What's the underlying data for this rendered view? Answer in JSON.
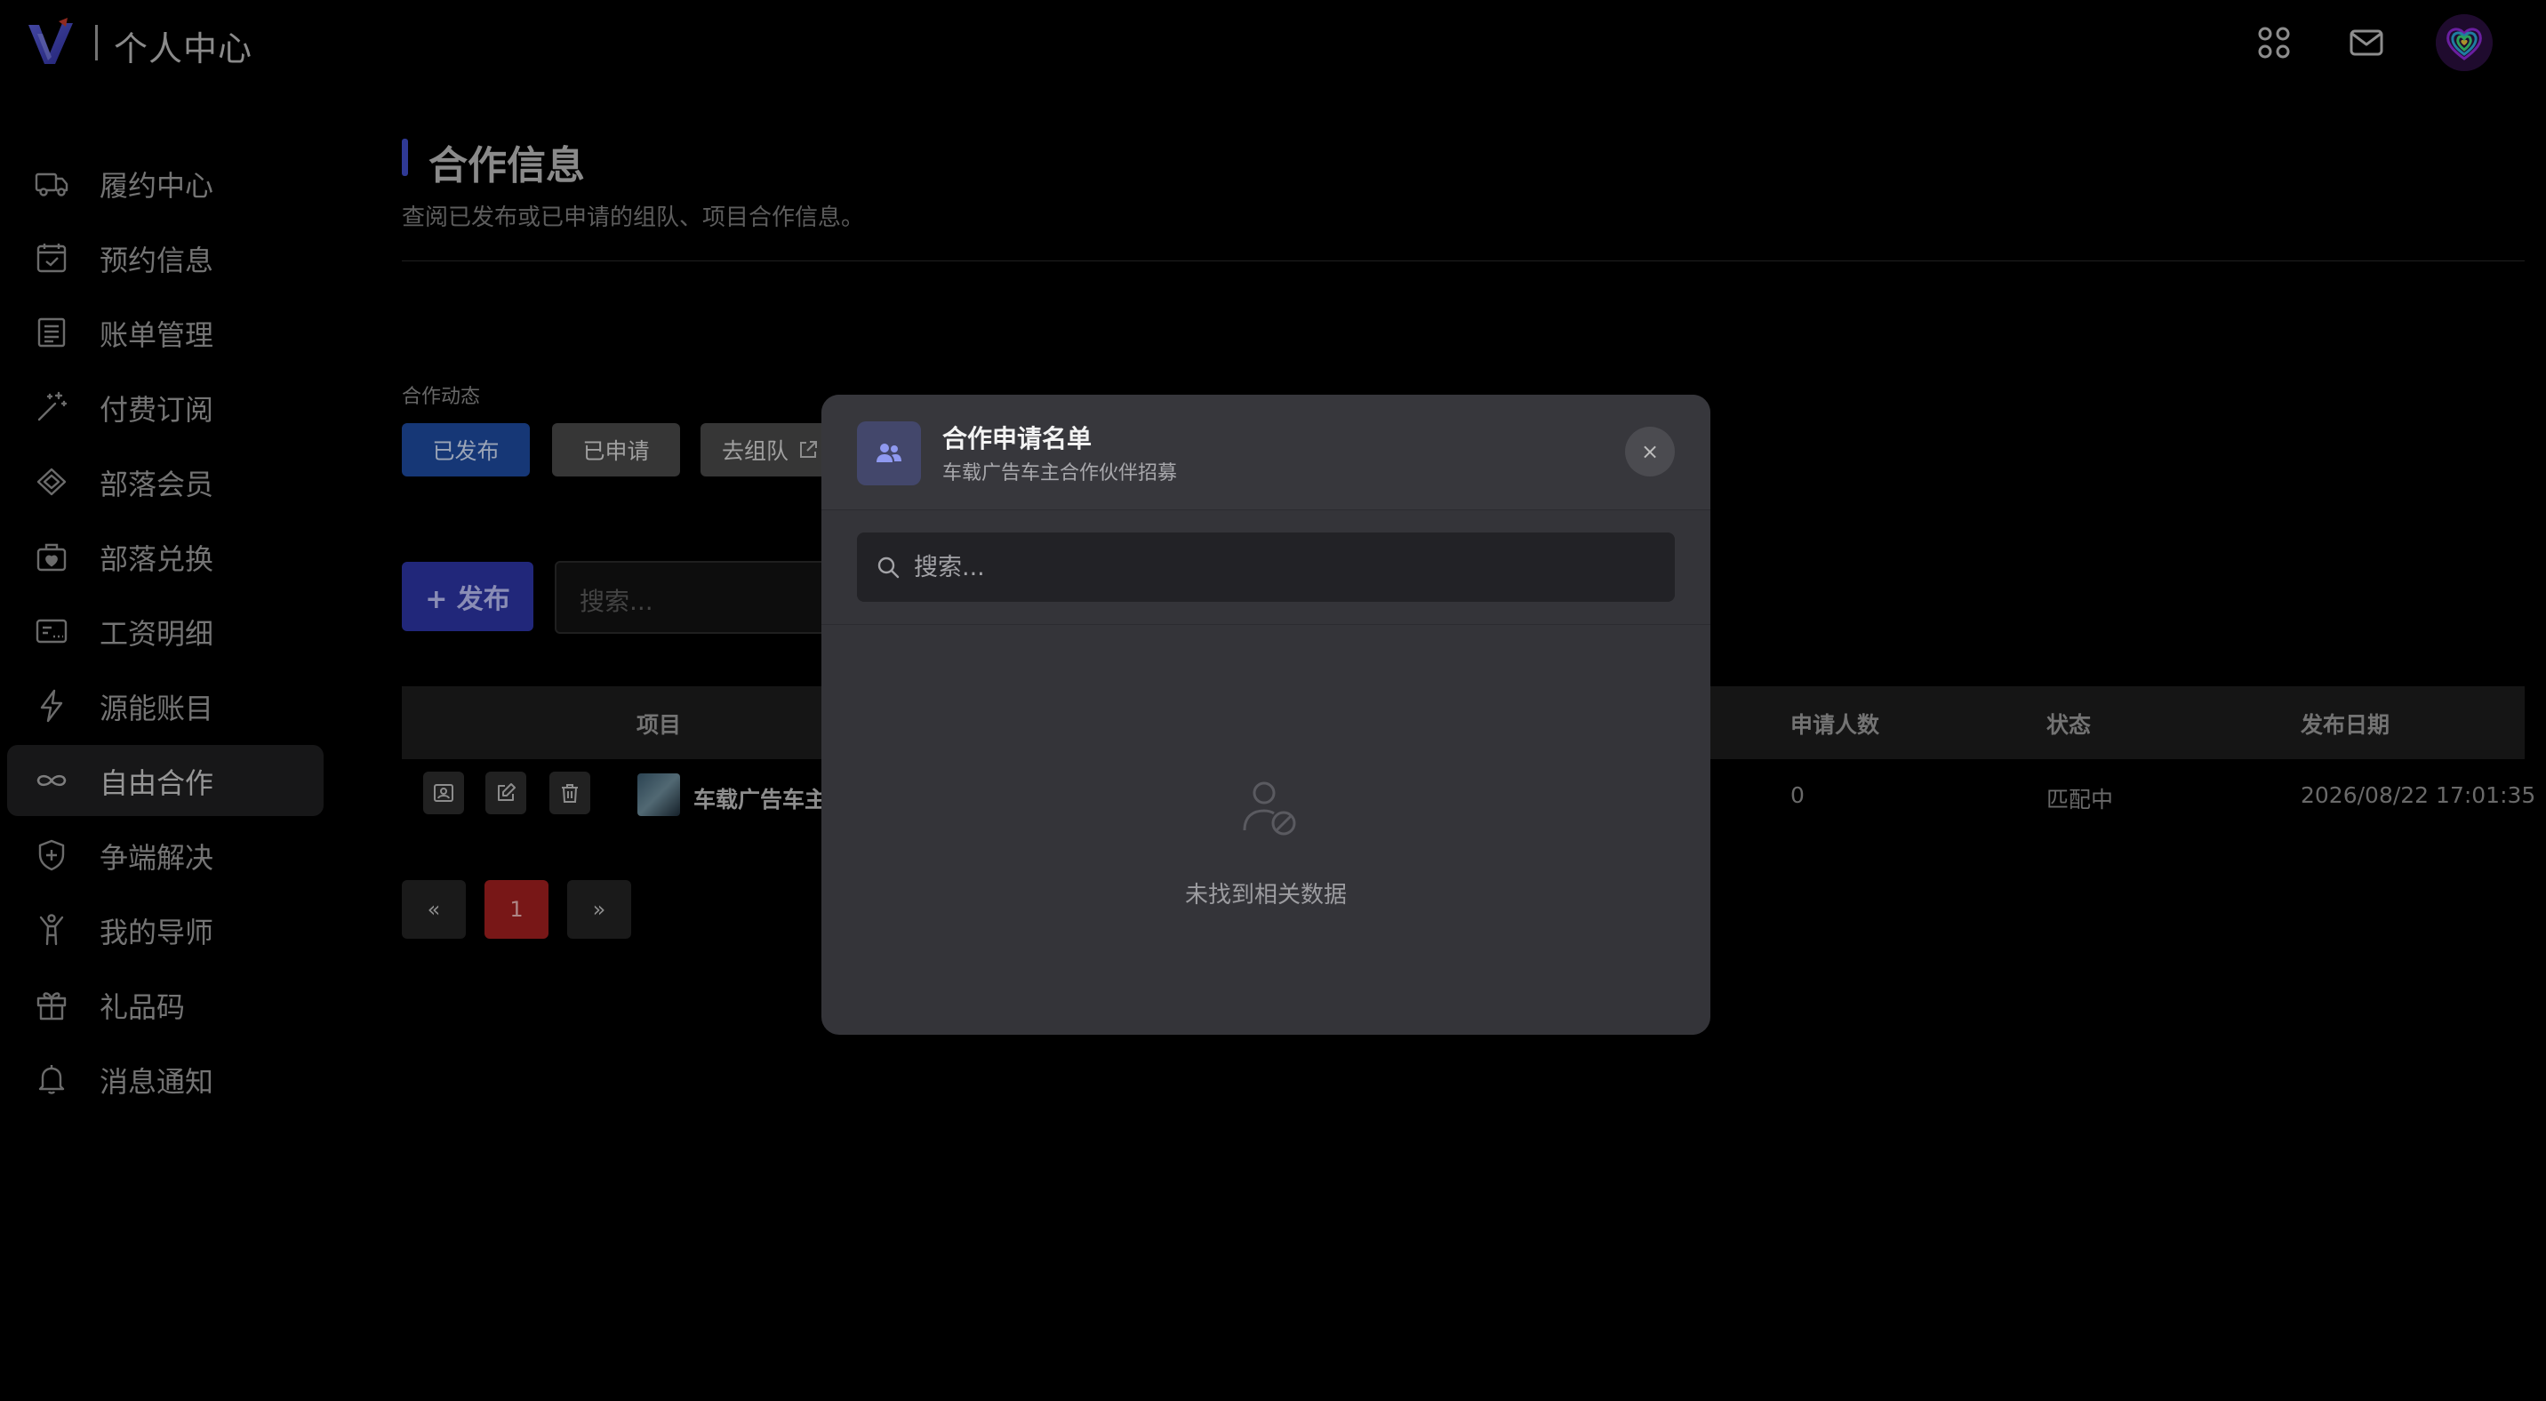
{
  "header": {
    "title": "个人中心"
  },
  "sidebar": {
    "items": [
      {
        "label": "履约中心",
        "icon": "truck-icon"
      },
      {
        "label": "预约信息",
        "icon": "calendar-check-icon"
      },
      {
        "label": "账单管理",
        "icon": "receipt-icon"
      },
      {
        "label": "付费订阅",
        "icon": "magic-wand-icon"
      },
      {
        "label": "部落会员",
        "icon": "diamond-icon"
      },
      {
        "label": "部落兑换",
        "icon": "gift-box-icon"
      },
      {
        "label": "工资明细",
        "icon": "payslip-icon"
      },
      {
        "label": "源能账目",
        "icon": "lightning-icon"
      },
      {
        "label": "自由合作",
        "icon": "infinity-icon",
        "active": true
      },
      {
        "label": "争端解决",
        "icon": "shield-plus-icon"
      },
      {
        "label": "我的导师",
        "icon": "person-cheer-icon"
      },
      {
        "label": "礼品码",
        "icon": "gift-icon"
      },
      {
        "label": "消息通知",
        "icon": "bell-icon"
      }
    ]
  },
  "main": {
    "title": "合作信息",
    "subtitle": "查阅已发布或已申请的组队、项目合作信息。",
    "section_label": "合作动态",
    "tabs": {
      "published": "已发布",
      "applied": "已申请",
      "team": "去组队"
    },
    "publish_button": "+ 发布",
    "search_placeholder": "搜索...",
    "table": {
      "headers": {
        "project": "项目",
        "applicants": "申请人数",
        "status": "状态",
        "date": "发布日期"
      },
      "rows": [
        {
          "project": "车载广告车主",
          "applicants": "0",
          "status": "匹配中",
          "date": "2026/08/22 17:01:35"
        }
      ]
    },
    "pagination": {
      "prev": "«",
      "current": "1",
      "next": "»"
    }
  },
  "modal": {
    "title": "合作申请名单",
    "subtitle": "车载广告车主合作伙伴招募",
    "close": "×",
    "search_placeholder": "搜索...",
    "empty_text": "未找到相关数据"
  },
  "colors": {
    "accent": "#3f4cc7",
    "primary_button": "#2d34a3",
    "tab_active": "#1e4a9e",
    "pager_current": "#a11f1f"
  }
}
